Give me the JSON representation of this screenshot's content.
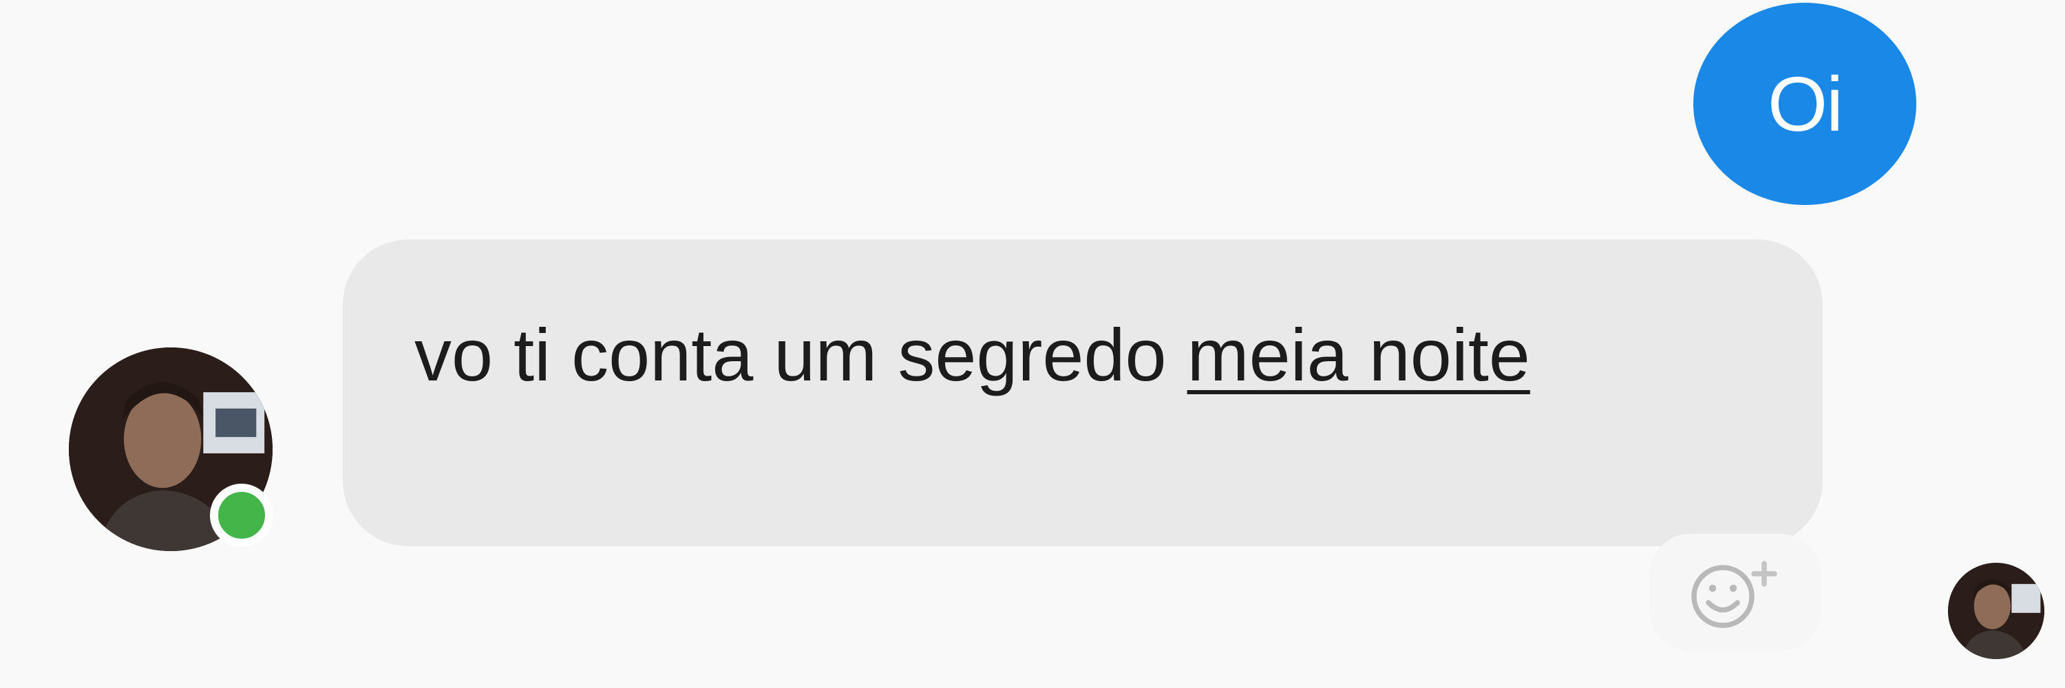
{
  "conversation": {
    "sent_message": "Oi",
    "received_message": {
      "text_before_link": "vo ti conta um segredo ",
      "link_text": "meia noite"
    }
  },
  "contact": {
    "avatar_icon": "profile-photo-icon",
    "online_status_color": "#44b548"
  },
  "reactions": {
    "add_reaction_icon": "smiley-plus-icon"
  },
  "read_receipt": {
    "avatar_icon": "profile-photo-icon"
  },
  "colors": {
    "sent_bubble": "#1a88e6",
    "received_bubble": "#e9e9e9",
    "background": "#f9f9f9"
  }
}
